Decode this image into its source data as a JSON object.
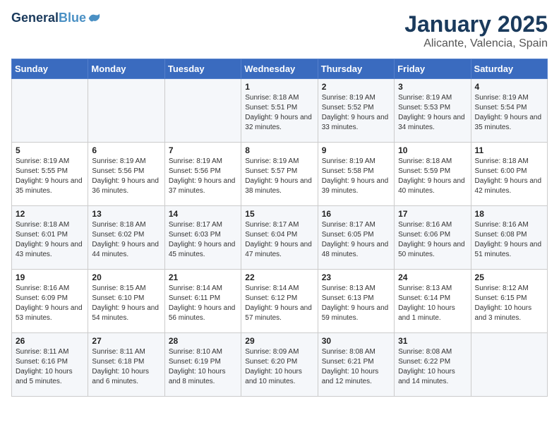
{
  "header": {
    "logo_line1": "General",
    "logo_line2": "Blue",
    "month": "January 2025",
    "location": "Alicante, Valencia, Spain"
  },
  "weekdays": [
    "Sunday",
    "Monday",
    "Tuesday",
    "Wednesday",
    "Thursday",
    "Friday",
    "Saturday"
  ],
  "weeks": [
    [
      {
        "day": "",
        "text": ""
      },
      {
        "day": "",
        "text": ""
      },
      {
        "day": "",
        "text": ""
      },
      {
        "day": "1",
        "text": "Sunrise: 8:18 AM\nSunset: 5:51 PM\nDaylight: 9 hours and 32 minutes."
      },
      {
        "day": "2",
        "text": "Sunrise: 8:19 AM\nSunset: 5:52 PM\nDaylight: 9 hours and 33 minutes."
      },
      {
        "day": "3",
        "text": "Sunrise: 8:19 AM\nSunset: 5:53 PM\nDaylight: 9 hours and 34 minutes."
      },
      {
        "day": "4",
        "text": "Sunrise: 8:19 AM\nSunset: 5:54 PM\nDaylight: 9 hours and 35 minutes."
      }
    ],
    [
      {
        "day": "5",
        "text": "Sunrise: 8:19 AM\nSunset: 5:55 PM\nDaylight: 9 hours and 35 minutes."
      },
      {
        "day": "6",
        "text": "Sunrise: 8:19 AM\nSunset: 5:56 PM\nDaylight: 9 hours and 36 minutes."
      },
      {
        "day": "7",
        "text": "Sunrise: 8:19 AM\nSunset: 5:56 PM\nDaylight: 9 hours and 37 minutes."
      },
      {
        "day": "8",
        "text": "Sunrise: 8:19 AM\nSunset: 5:57 PM\nDaylight: 9 hours and 38 minutes."
      },
      {
        "day": "9",
        "text": "Sunrise: 8:19 AM\nSunset: 5:58 PM\nDaylight: 9 hours and 39 minutes."
      },
      {
        "day": "10",
        "text": "Sunrise: 8:18 AM\nSunset: 5:59 PM\nDaylight: 9 hours and 40 minutes."
      },
      {
        "day": "11",
        "text": "Sunrise: 8:18 AM\nSunset: 6:00 PM\nDaylight: 9 hours and 42 minutes."
      }
    ],
    [
      {
        "day": "12",
        "text": "Sunrise: 8:18 AM\nSunset: 6:01 PM\nDaylight: 9 hours and 43 minutes."
      },
      {
        "day": "13",
        "text": "Sunrise: 8:18 AM\nSunset: 6:02 PM\nDaylight: 9 hours and 44 minutes."
      },
      {
        "day": "14",
        "text": "Sunrise: 8:17 AM\nSunset: 6:03 PM\nDaylight: 9 hours and 45 minutes."
      },
      {
        "day": "15",
        "text": "Sunrise: 8:17 AM\nSunset: 6:04 PM\nDaylight: 9 hours and 47 minutes."
      },
      {
        "day": "16",
        "text": "Sunrise: 8:17 AM\nSunset: 6:05 PM\nDaylight: 9 hours and 48 minutes."
      },
      {
        "day": "17",
        "text": "Sunrise: 8:16 AM\nSunset: 6:06 PM\nDaylight: 9 hours and 50 minutes."
      },
      {
        "day": "18",
        "text": "Sunrise: 8:16 AM\nSunset: 6:08 PM\nDaylight: 9 hours and 51 minutes."
      }
    ],
    [
      {
        "day": "19",
        "text": "Sunrise: 8:16 AM\nSunset: 6:09 PM\nDaylight: 9 hours and 53 minutes."
      },
      {
        "day": "20",
        "text": "Sunrise: 8:15 AM\nSunset: 6:10 PM\nDaylight: 9 hours and 54 minutes."
      },
      {
        "day": "21",
        "text": "Sunrise: 8:14 AM\nSunset: 6:11 PM\nDaylight: 9 hours and 56 minutes."
      },
      {
        "day": "22",
        "text": "Sunrise: 8:14 AM\nSunset: 6:12 PM\nDaylight: 9 hours and 57 minutes."
      },
      {
        "day": "23",
        "text": "Sunrise: 8:13 AM\nSunset: 6:13 PM\nDaylight: 9 hours and 59 minutes."
      },
      {
        "day": "24",
        "text": "Sunrise: 8:13 AM\nSunset: 6:14 PM\nDaylight: 10 hours and 1 minute."
      },
      {
        "day": "25",
        "text": "Sunrise: 8:12 AM\nSunset: 6:15 PM\nDaylight: 10 hours and 3 minutes."
      }
    ],
    [
      {
        "day": "26",
        "text": "Sunrise: 8:11 AM\nSunset: 6:16 PM\nDaylight: 10 hours and 5 minutes."
      },
      {
        "day": "27",
        "text": "Sunrise: 8:11 AM\nSunset: 6:18 PM\nDaylight: 10 hours and 6 minutes."
      },
      {
        "day": "28",
        "text": "Sunrise: 8:10 AM\nSunset: 6:19 PM\nDaylight: 10 hours and 8 minutes."
      },
      {
        "day": "29",
        "text": "Sunrise: 8:09 AM\nSunset: 6:20 PM\nDaylight: 10 hours and 10 minutes."
      },
      {
        "day": "30",
        "text": "Sunrise: 8:08 AM\nSunset: 6:21 PM\nDaylight: 10 hours and 12 minutes."
      },
      {
        "day": "31",
        "text": "Sunrise: 8:08 AM\nSunset: 6:22 PM\nDaylight: 10 hours and 14 minutes."
      },
      {
        "day": "",
        "text": ""
      }
    ]
  ]
}
